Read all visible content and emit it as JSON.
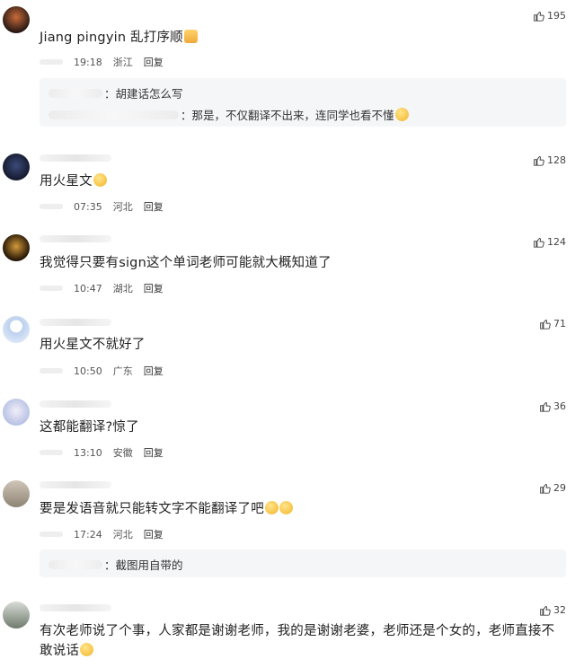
{
  "comments": [
    {
      "username": "Jiang pingyin",
      "text": "乱打序顺",
      "time": "19:18",
      "location": "浙江",
      "reply_label": "回复",
      "likes": "195",
      "replies": [
        {
          "text": "胡建话怎么写"
        },
        {
          "text": "那是，不仅翻译不出来，连同学也看不懂"
        }
      ]
    },
    {
      "text": "用火星文",
      "time": "07:35",
      "location": "河北",
      "reply_label": "回复",
      "likes": "128"
    },
    {
      "text": "我觉得只要有sign这个单词老师可能就大概知道了",
      "time": "10:47",
      "location": "湖北",
      "reply_label": "回复",
      "likes": "124"
    },
    {
      "text": "用火星文不就好了",
      "time": "10:50",
      "location": "广东",
      "reply_label": "回复",
      "likes": "71"
    },
    {
      "text": "这都能翻译?惊了",
      "time": "13:10",
      "location": "安徽",
      "reply_label": "回复",
      "likes": "36"
    },
    {
      "text": "要是发语音就只能转文字不能翻译了吧",
      "time": "17:24",
      "location": "河北",
      "reply_label": "回复",
      "likes": "29",
      "replies": [
        {
          "text": "截图用自带的"
        }
      ]
    },
    {
      "text": "有次老师说了个事，人家都是谢谢老师，我的是谢谢老婆，老师还是个女的，老师直接不敢说话",
      "likes": "32"
    }
  ],
  "icons": {
    "like": "thumbs-up-icon",
    "emoji": "smile-emoji-icon"
  },
  "colors": {
    "reply_bg": "#f5f6f7",
    "text": "#222222",
    "meta": "#555555"
  }
}
